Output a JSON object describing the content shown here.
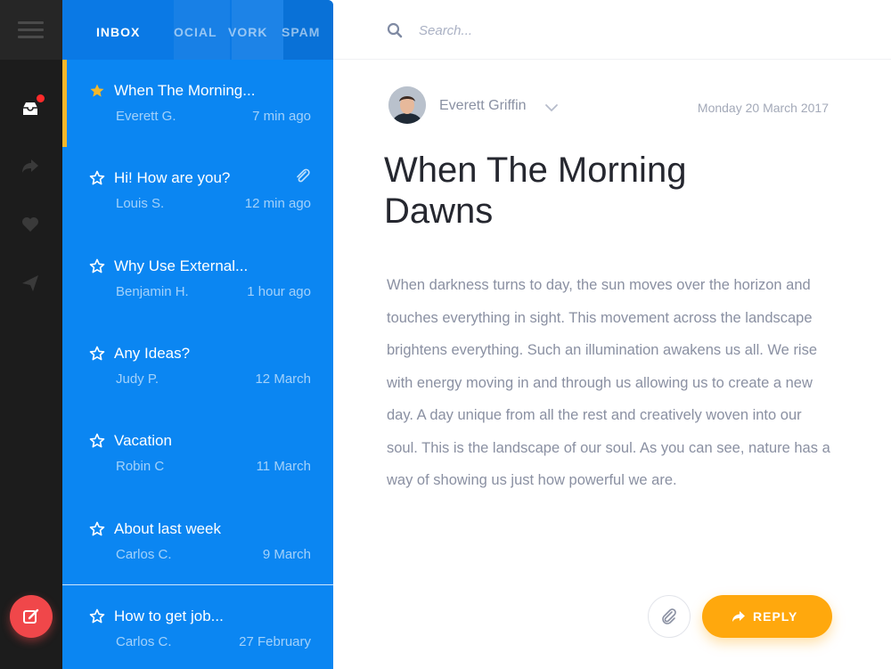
{
  "tabs": [
    {
      "label": "INBOX",
      "active": true
    },
    {
      "label": "OCIAL",
      "active": false
    },
    {
      "label": "VORK",
      "active": false
    },
    {
      "label": "SPAM",
      "active": false
    }
  ],
  "nav": {
    "icons": [
      "inbox-icon",
      "forward-icon",
      "heart-icon",
      "send-icon"
    ],
    "compose_icon": "compose-icon",
    "badge_color": "#ff2a2a"
  },
  "mails": [
    {
      "subject": "When The Morning...",
      "sender": "Everett G.",
      "time": "7 min ago",
      "starred": true,
      "active": true,
      "attachment": false
    },
    {
      "subject": "Hi! How are you?",
      "sender": "Louis S.",
      "time": "12 min ago",
      "starred": false,
      "active": false,
      "attachment": true
    },
    {
      "subject": "Why Use External...",
      "sender": "Benjamin H.",
      "time": "1 hour ago",
      "starred": false,
      "active": false,
      "attachment": false
    },
    {
      "subject": "Any Ideas?",
      "sender": "Judy P.",
      "time": "12 March",
      "starred": false,
      "active": false,
      "attachment": false
    },
    {
      "subject": "Vacation",
      "sender": "Robin C",
      "time": "11 March",
      "starred": false,
      "active": false,
      "attachment": false
    },
    {
      "subject": "About last week",
      "sender": "Carlos C.",
      "time": "9 March",
      "starred": false,
      "active": false,
      "attachment": false
    },
    {
      "subject": "How to get job...",
      "sender": "Carlos C.",
      "time": "27 February",
      "starred": false,
      "active": false,
      "attachment": false
    }
  ],
  "search": {
    "placeholder": "Search..."
  },
  "message": {
    "sender": "Everett Griffin",
    "date": "Monday 20 March 2017",
    "title": "When The Morning Dawns",
    "body": "When darkness turns to day, the sun moves over the horizon and touches everything in sight. This movement across the landscape brightens everything. Such an illumination awakens us all. We rise with energy moving in and through us allowing us to create a new day. A day unique from all the rest and creatively woven into our soul. This is the landscape of our soul. As you can see, nature has a way of showing us just how powerful we are."
  },
  "actions": {
    "reply_label": "REPLY"
  },
  "colors": {
    "rail": "#1c1c1c",
    "list": "#0b86f2",
    "accent_star": "#f4b72a",
    "reply": "#ffa80d",
    "compose": "#f0474a"
  }
}
